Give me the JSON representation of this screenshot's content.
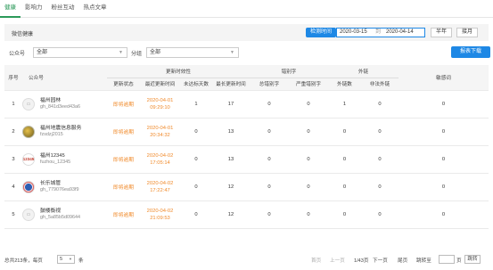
{
  "tabs": [
    "健康",
    "影响力",
    "粉丝互动",
    "热点文章"
  ],
  "toolbar": {
    "title": "微信健康",
    "date_button": "检测时间",
    "date_start": "2020-03-15",
    "date_sep": "到",
    "date_end": "2020-04-14",
    "half_year": "半年",
    "one_month": "接月"
  },
  "filters": {
    "account_label": "公众号",
    "account_value": "全部",
    "group_label": "分组",
    "group_value": "全部",
    "download": "报表下载"
  },
  "table": {
    "headers": {
      "index": "序号",
      "account": "公众号",
      "timeliness": "更新时效性",
      "typos": "错别字",
      "links": "外链",
      "sensitive": "敏感词"
    },
    "sub_headers": [
      "更新状态",
      "最近更新时间",
      "未达标天数",
      "最长更新时间",
      "总错别字",
      "严重错别字",
      "外链数",
      "非法外链"
    ],
    "rows": [
      {
        "no": "1",
        "name": "福州园林",
        "id": "gh_841d3eed43a6",
        "status": "即将逾期",
        "time1": "2020-04-01",
        "time2": "09:29:10",
        "days": "1",
        "longest": "17",
        "typo": "0",
        "severe": "0",
        "link": "1",
        "illegal": "0",
        "sensitive": "0",
        "avatar": "placeholder"
      },
      {
        "no": "2",
        "name": "福州地震信息服务",
        "id": "fzsdzj2015",
        "status": "即将逾期",
        "time1": "2020-04-01",
        "time2": "20:34:32",
        "days": "0",
        "longest": "13",
        "typo": "0",
        "severe": "0",
        "link": "0",
        "illegal": "0",
        "sensitive": "0",
        "avatar": "globe"
      },
      {
        "no": "3",
        "name": "福州12345",
        "id": "fuzhou_12345",
        "status": "即将逾期",
        "time1": "2020-04-02",
        "time2": "17:05:14",
        "days": "0",
        "longest": "13",
        "typo": "0",
        "severe": "0",
        "link": "0",
        "illegal": "0",
        "sensitive": "0",
        "avatar": "12345"
      },
      {
        "no": "4",
        "name": "长乐城管",
        "id": "gh_779076ea93f9",
        "status": "即将逾期",
        "time1": "2020-04-02",
        "time2": "17:22:47",
        "days": "0",
        "longest": "12",
        "typo": "0",
        "severe": "0",
        "link": "0",
        "illegal": "0",
        "sensitive": "0",
        "avatar": "emblem"
      },
      {
        "no": "5",
        "name": "鼓楼衡视",
        "id": "gh_5a85b5d09644",
        "status": "即将逾期",
        "time1": "2020-04-02",
        "time2": "21:09:53",
        "days": "0",
        "longest": "12",
        "typo": "0",
        "severe": "0",
        "link": "0",
        "illegal": "0",
        "sensitive": "0",
        "avatar": "placeholder"
      }
    ]
  },
  "footer": {
    "total": "总共213条，每页",
    "per_page": "5",
    "unit": "条",
    "first": "首页",
    "prev": "上一页",
    "page_info": "1/43页",
    "next": "下一页",
    "last": "尾页",
    "jump": "跳转至",
    "page_unit": "页",
    "go": "跳转"
  },
  "colors": {
    "accent": "#1e88e5",
    "tab_active": "#2c9a5a",
    "warning": "#f08a2b"
  }
}
